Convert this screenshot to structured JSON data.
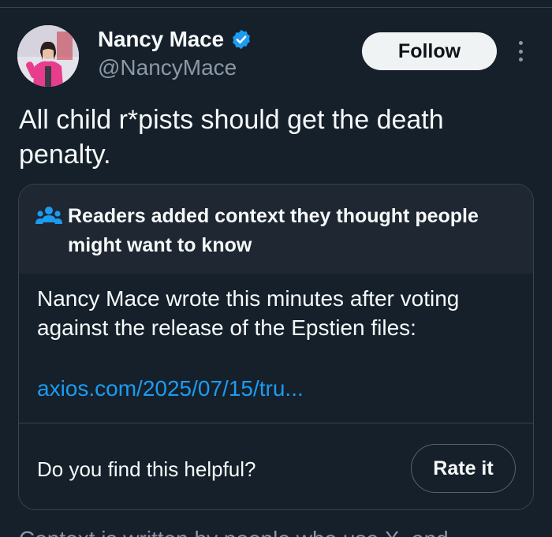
{
  "tweet": {
    "author": {
      "display_name": "Nancy Mace",
      "handle": "@NancyMace",
      "verified": true
    },
    "follow_label": "Follow",
    "text": "All child r*pists should get the death penalty."
  },
  "community_note": {
    "title": "Readers added context they thought people might want to know",
    "body": "Nancy Mace wrote this minutes after voting against the release of the Epstien files:",
    "link_text": "axios.com/2025/07/15/tru...",
    "helpful_question": "Do you find this helpful?",
    "rate_label": "Rate it"
  },
  "footer": {
    "text": "Context is written by people who use X, and..."
  },
  "colors": {
    "background": "#15202b",
    "accent": "#1d9bf0",
    "secondary_text": "#8b98a5"
  },
  "icons": {
    "verified": "verified-badge-icon",
    "more": "more-options-icon",
    "people": "people-icon"
  }
}
